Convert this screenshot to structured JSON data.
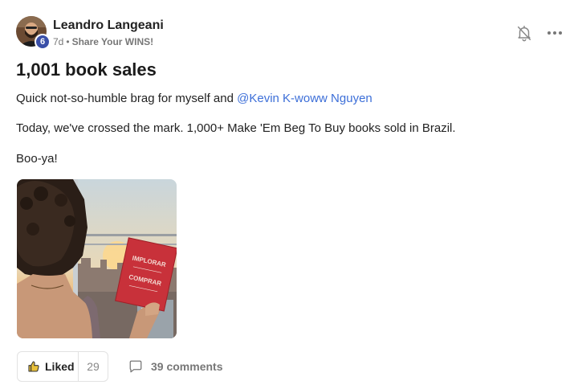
{
  "post": {
    "author": "Leandro Langeani",
    "level": "6",
    "time_ago": "7d",
    "separator": "•",
    "category": "Share Your WINS!",
    "title": "1,001 book sales",
    "paragraph1_text": "Quick not-so-humble brag for myself and ",
    "paragraph1_mention": "@Kevin K-woww Nguyen",
    "paragraph2": "Today, we've crossed the mark. 1,000+ Make 'Em Beg To Buy books sold in Brazil.",
    "paragraph3": "Boo-ya!"
  },
  "book_cover": {
    "line1": "IMPLORAR",
    "line2": "COMPRAR"
  },
  "actions": {
    "like_label": "Liked",
    "like_count": "29",
    "comments_label": "39 comments"
  },
  "icons": {
    "bell": "bell-off-icon",
    "more": "more-horizontal-icon",
    "like": "thumbs-up-icon",
    "comment": "comment-bubble-icon"
  },
  "colors": {
    "accent_link": "#3d6fd8",
    "badge": "#3a4fa8",
    "book": "#c8313a"
  }
}
